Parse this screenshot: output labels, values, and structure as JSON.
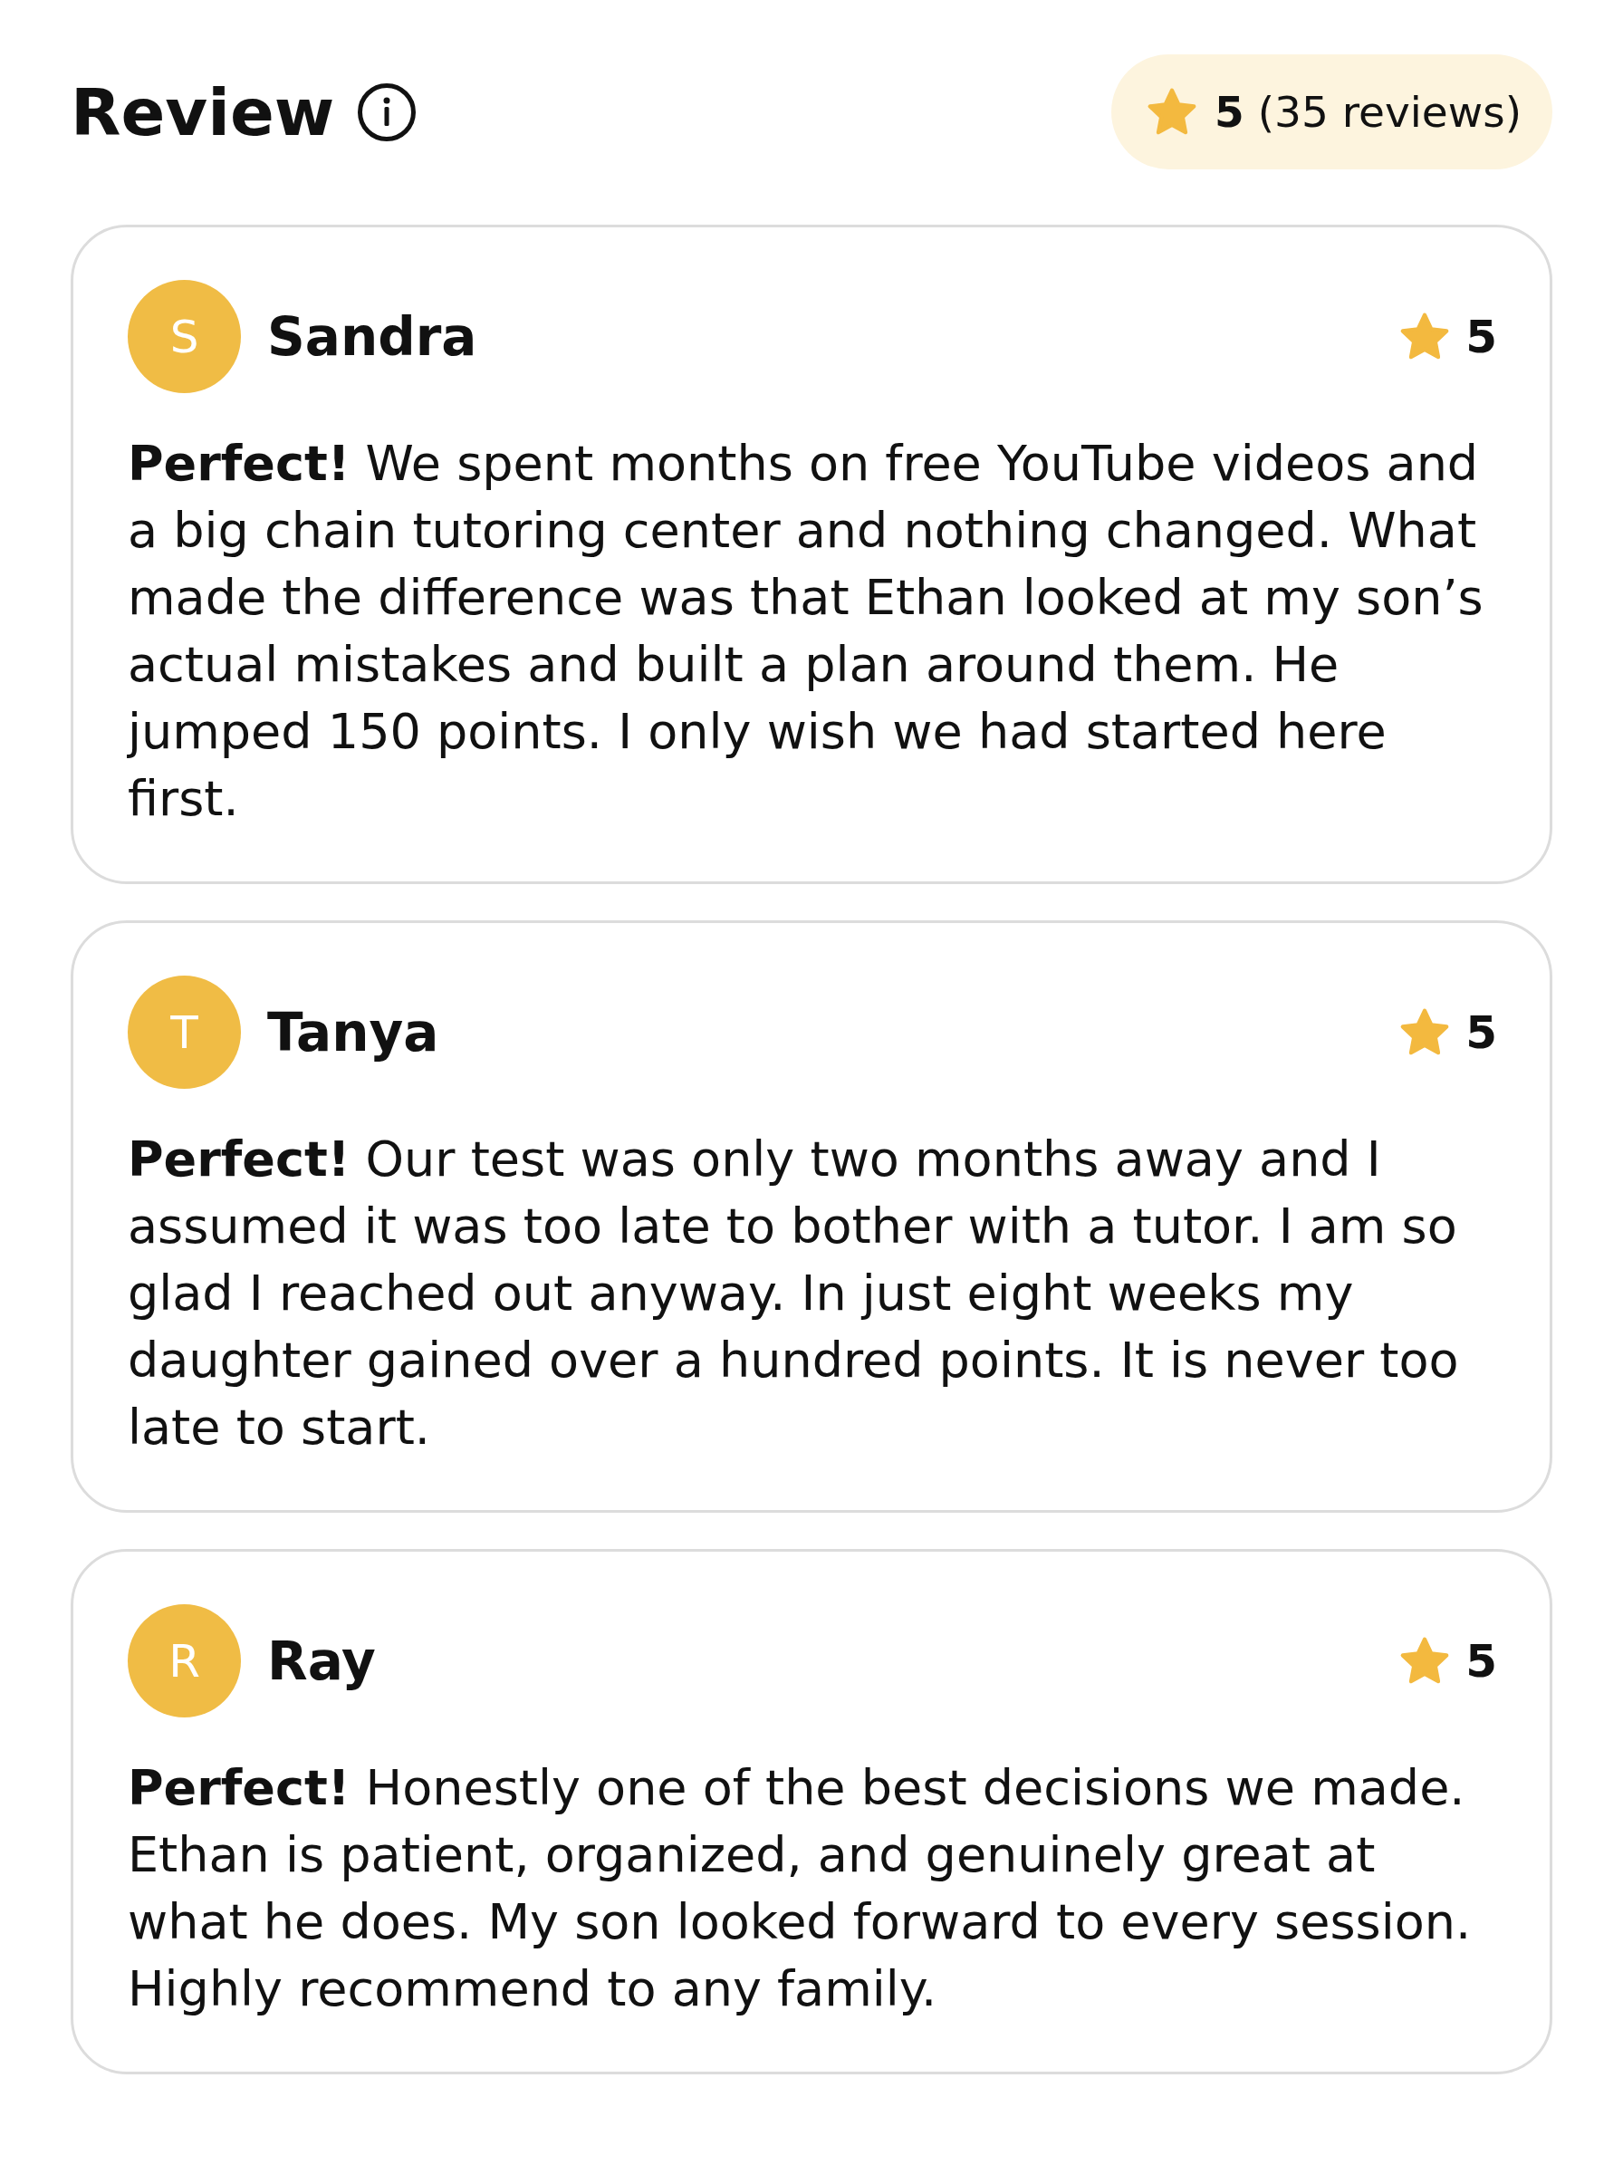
{
  "header": {
    "title": "Review",
    "rating_summary": "**5** (35 reviews)"
  },
  "reviews": [
    {
      "initial": "S",
      "name": "Sandra",
      "rating": "5",
      "text": "**Perfect!** We spent months on free YouTube videos and a big chain tutoring center and nothing changed. What made the difference was that Ethan looked at my son’s actual mistakes and built a plan around them. He jumped 150 points. I only wish we had started here first."
    },
    {
      "initial": "T",
      "name": "Tanya",
      "rating": "5",
      "text": "**Perfect!** Our test was only two months away and I assumed it was too late to bother with a tutor. I am so glad I reached out anyway. In just eight weeks my daughter gained over a hundred points. It is never too late to start."
    },
    {
      "initial": "R",
      "name": "Ray",
      "rating": "5",
      "text": "**Perfect!** Honestly one of the best decisions we made. Ethan is patient, organized, and genuinely great at what he does. My son looked forward to every session. Highly recommend to any family."
    }
  ]
}
